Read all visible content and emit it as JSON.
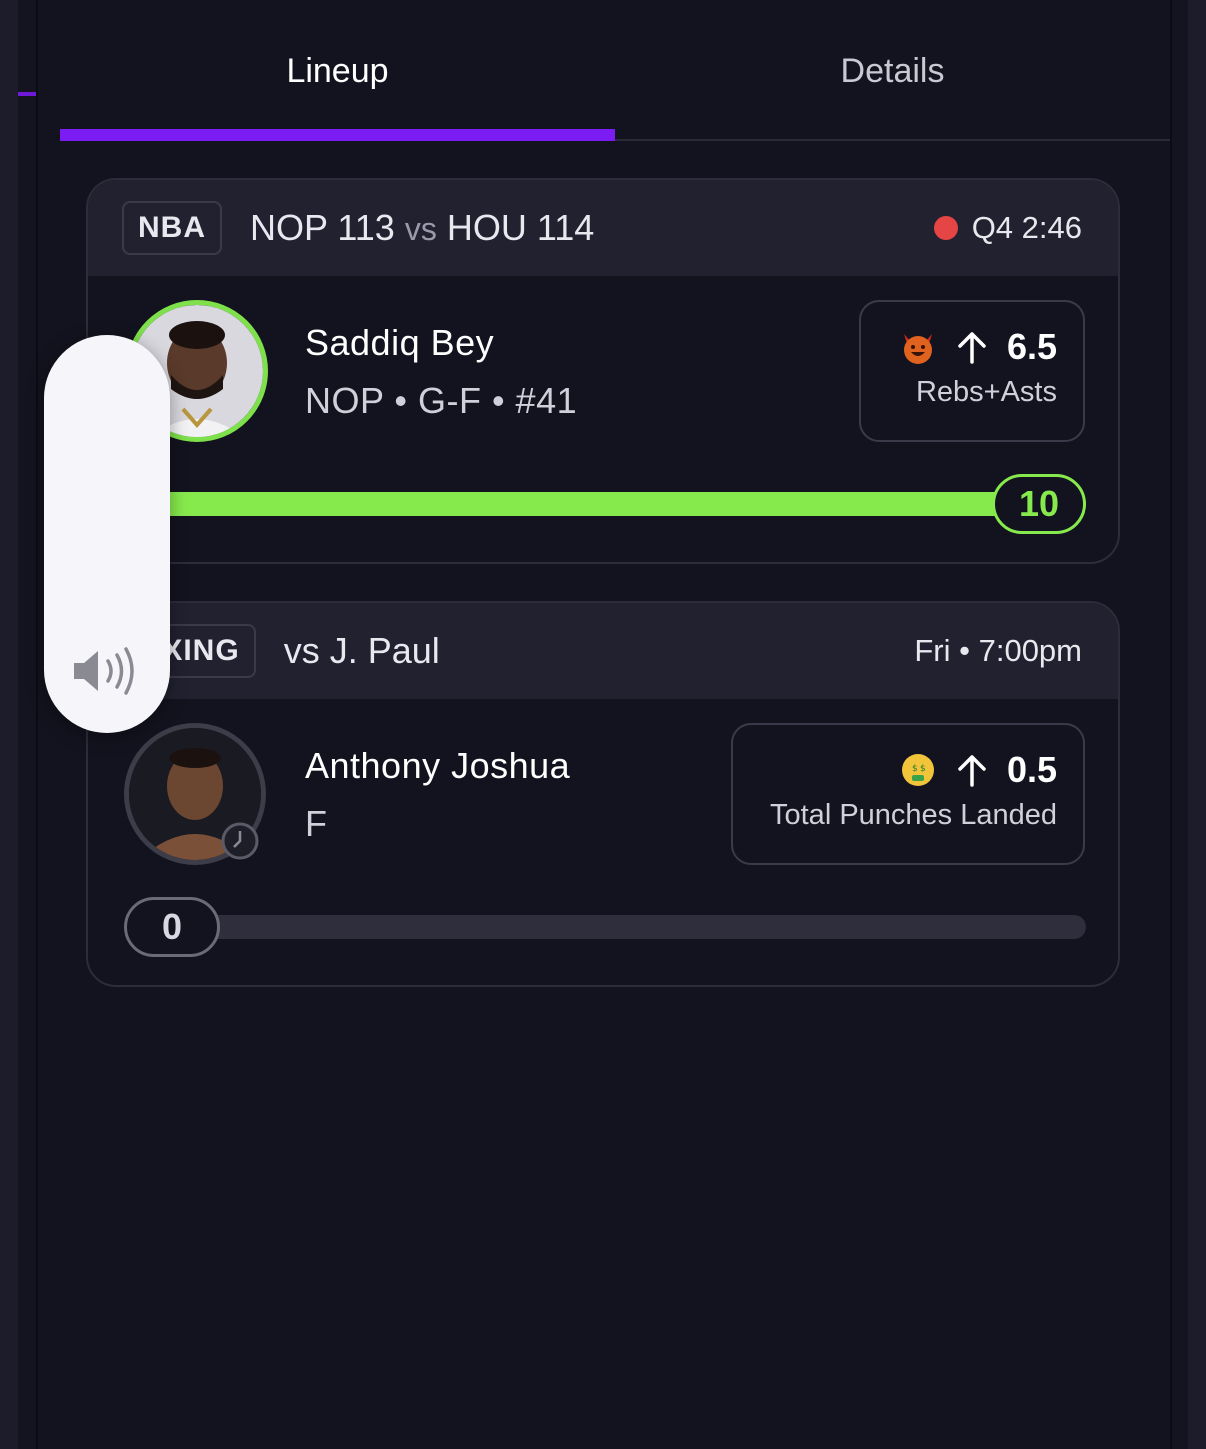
{
  "tabs": [
    {
      "label": "Lineup",
      "active": true
    },
    {
      "label": "Details",
      "active": false
    }
  ],
  "cards": [
    {
      "league": "NBA",
      "matchup": {
        "team1": "NOP",
        "score1": "113",
        "vs": "vs",
        "team2": "HOU",
        "score2": "114"
      },
      "status": {
        "live": true,
        "text": "Q4 2:46"
      },
      "player": {
        "name": "Saddiq Bey",
        "sub": "NOP • G-F • #41"
      },
      "prop": {
        "emoji": "devil-face-icon",
        "direction": "up",
        "line": "6.5",
        "stat": "Rebs+Asts"
      },
      "progress": {
        "value": "10",
        "fraction": 1.0,
        "color": "#86ea4c"
      }
    },
    {
      "league": "OXING",
      "matchup": {
        "text": "vs J. Paul"
      },
      "status": {
        "live": false,
        "text": "Fri • 7:00pm"
      },
      "player": {
        "name": "Anthony Joshua",
        "sub": "F"
      },
      "prop": {
        "emoji": "money-mouth-face-icon",
        "direction": "up",
        "line": "0.5",
        "stat": "Total Punches Landed"
      },
      "progress": {
        "value": "0",
        "fraction": 0.0
      }
    }
  ],
  "colors": {
    "accent": "#7b1cf2",
    "live": "#e64545",
    "success": "#86ea4c",
    "background": "#13131f",
    "header": "#212130"
  },
  "overlay": {
    "type": "volume-hud",
    "icon": "speaker-volume-icon"
  }
}
